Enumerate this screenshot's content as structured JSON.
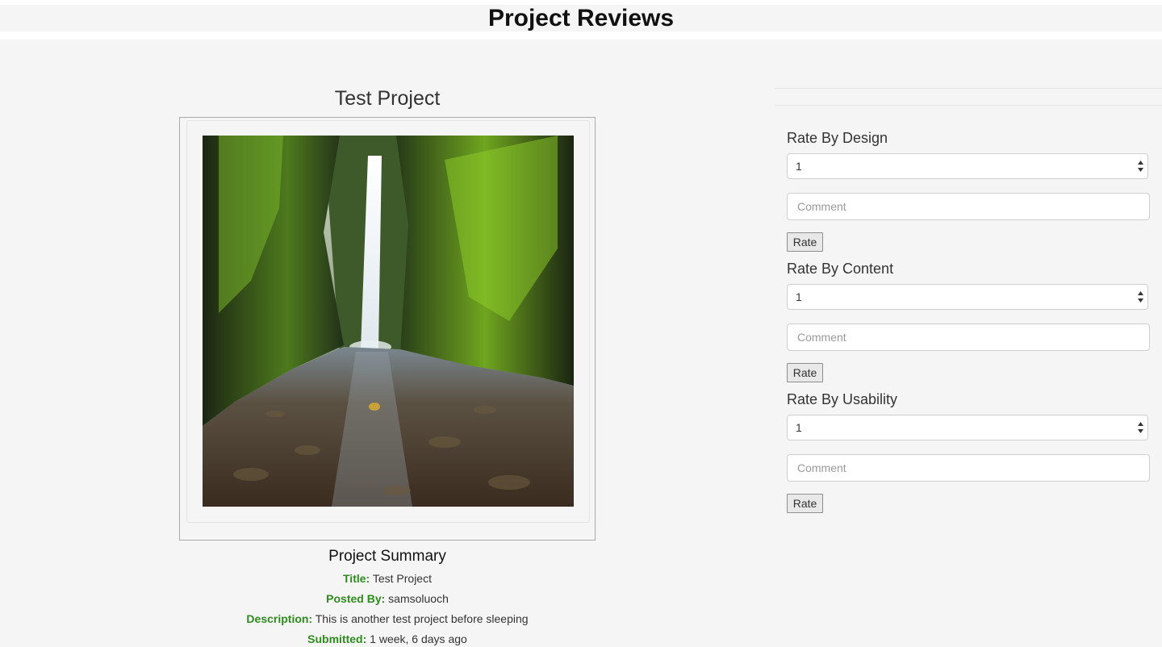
{
  "header": {
    "title": "Project Reviews"
  },
  "project": {
    "title": "Test Project",
    "image_alt": "waterfall-photo",
    "summary": {
      "heading": "Project Summary",
      "title_label": "Title:",
      "title_value": "Test Project",
      "posted_label": "Posted By:",
      "posted_value": "samsoluoch",
      "description_label": "Description:",
      "description_value": "This is another test project before sleeping",
      "submitted_label": "Submitted:",
      "submitted_value": "1 week, 6 days ago"
    }
  },
  "ratings": [
    {
      "heading": "Rate By Design",
      "selected": "1",
      "comment_placeholder": "Comment",
      "button_label": "Rate"
    },
    {
      "heading": "Rate By Content",
      "selected": "1",
      "comment_placeholder": "Comment",
      "button_label": "Rate"
    },
    {
      "heading": "Rate By Usability",
      "selected": "1",
      "comment_placeholder": "Comment",
      "button_label": "Rate"
    }
  ],
  "colors": {
    "label_green": "#2e8b1e",
    "background": "#f5f5f5"
  }
}
